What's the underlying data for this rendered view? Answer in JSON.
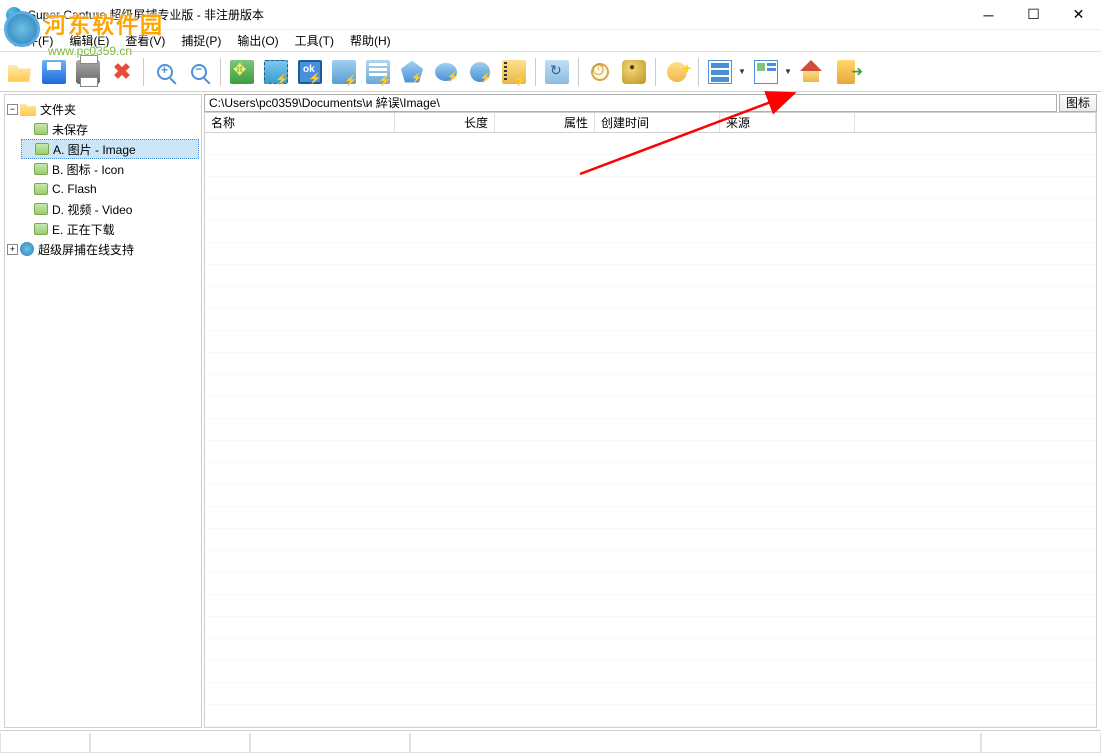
{
  "title": "Super Capture 超级屏捕专业版 - 非注册版本",
  "watermark": {
    "brand": "河东软件园",
    "url": "www.pc0359.cn"
  },
  "menubar": [
    {
      "label": "文件(F)"
    },
    {
      "label": "编辑(E)"
    },
    {
      "label": "查看(V)"
    },
    {
      "label": "捕捉(P)"
    },
    {
      "label": "输出(O)"
    },
    {
      "label": "工具(T)"
    },
    {
      "label": "帮助(H)"
    }
  ],
  "tree": {
    "root_label": "文件夹",
    "items": [
      "未保存",
      "A. 图片 - Image",
      "B. 图标 - Icon",
      "C. Flash",
      "D. 视频 - Video",
      "E. 正在下载"
    ],
    "online_label": "超级屏捕在线支持"
  },
  "path": "C:\\Users\\pc0359\\Documents\\и   綷误\\Image\\",
  "path_btn": "图标",
  "columns": {
    "name": "名称",
    "length": "长度",
    "attr": "属性",
    "created": "创建时间",
    "source": "来源"
  },
  "column_widths": {
    "name": 190,
    "length": 100,
    "attr": 100,
    "created": 125,
    "source": 135
  }
}
